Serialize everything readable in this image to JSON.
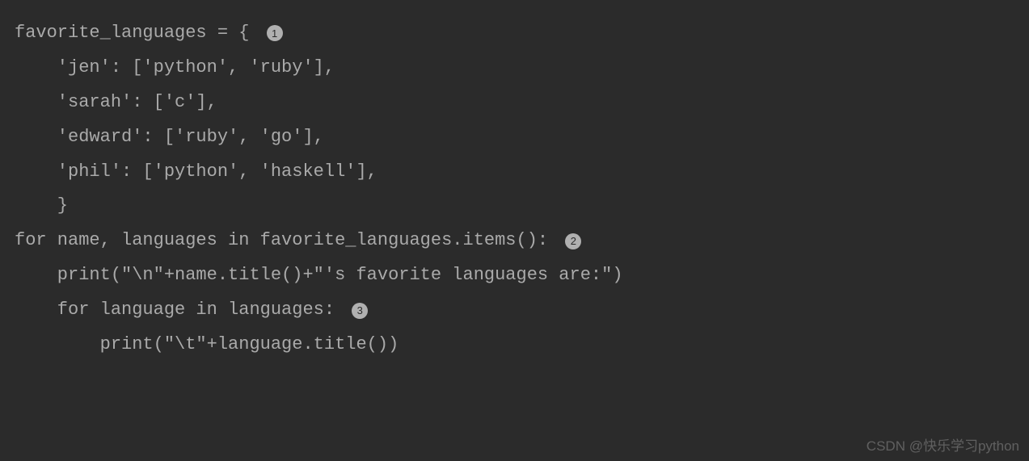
{
  "code": {
    "line1": "favorite_languages = { ",
    "line2": "    'jen': ['python', 'ruby'],",
    "line3": "    'sarah': ['c'],",
    "line4": "    'edward': ['ruby', 'go'],",
    "line5": "    'phil': ['python', 'haskell'],",
    "line6": "    }",
    "line7": "for name, languages in favorite_languages.items(): ",
    "line8": "    print(\"\\n\"+name.title()+\"'s favorite languages are:\")",
    "line9": "    for language in languages: ",
    "line10": "        print(\"\\t\"+language.title())"
  },
  "annotations": {
    "num1": "1",
    "num2": "2",
    "num3": "3"
  },
  "watermark": "CSDN @快乐学习python"
}
